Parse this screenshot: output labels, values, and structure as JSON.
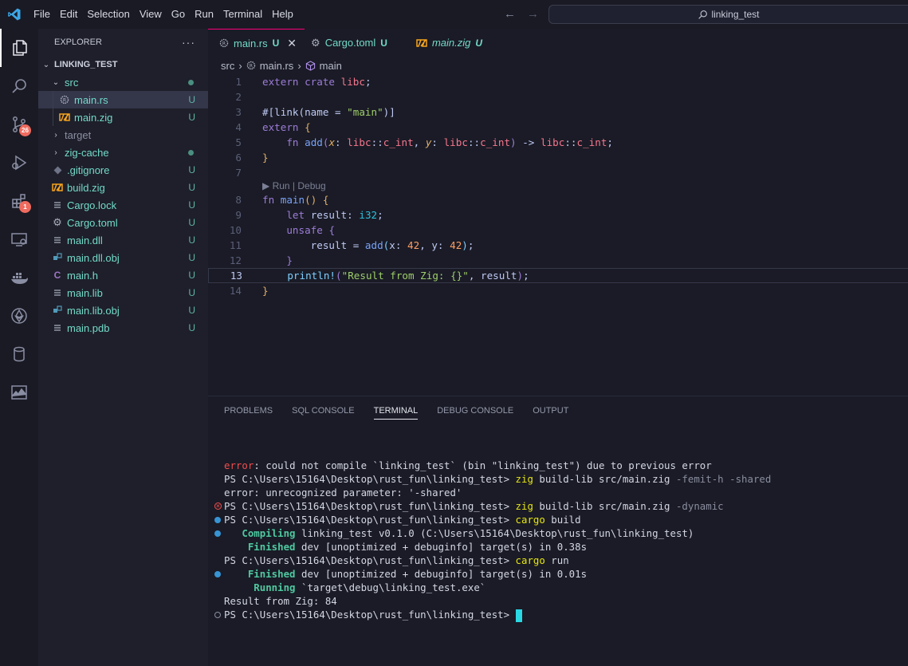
{
  "menu": [
    "File",
    "Edit",
    "Selection",
    "View",
    "Go",
    "Run",
    "Terminal",
    "Help"
  ],
  "search": {
    "text": "linking_test"
  },
  "activity": {
    "scm_badge": "26",
    "extensions_badge": "1"
  },
  "explorer": {
    "title": "EXPLORER",
    "more": "···",
    "root": "LINKING_TEST",
    "items": [
      {
        "label": "src",
        "status": ""
      },
      {
        "label": "main.rs",
        "status": "U"
      },
      {
        "label": "main.zig",
        "status": "U"
      },
      {
        "label": "target",
        "status": ""
      },
      {
        "label": "zig-cache",
        "status": ""
      },
      {
        "label": ".gitignore",
        "status": "U"
      },
      {
        "label": "build.zig",
        "status": "U"
      },
      {
        "label": "Cargo.lock",
        "status": "U"
      },
      {
        "label": "Cargo.toml",
        "status": "U"
      },
      {
        "label": "main.dll",
        "status": "U"
      },
      {
        "label": "main.dll.obj",
        "status": "U"
      },
      {
        "label": "main.h",
        "status": "U"
      },
      {
        "label": "main.lib",
        "status": "U"
      },
      {
        "label": "main.lib.obj",
        "status": "U"
      },
      {
        "label": "main.pdb",
        "status": "U"
      }
    ]
  },
  "tabs": [
    {
      "label": "main.rs",
      "status": "U"
    },
    {
      "label": "Cargo.toml",
      "status": "U"
    },
    {
      "label": "main.zig",
      "status": "U"
    }
  ],
  "breadcrumb": {
    "folder": "src",
    "file": "main.rs",
    "symbol": "main"
  },
  "editor": {
    "line_numbers": [
      "1",
      "2",
      "3",
      "4",
      "5",
      "6",
      "7",
      "8",
      "9",
      "10",
      "11",
      "12",
      "13",
      "14"
    ],
    "codelens": "▶ Run | Debug"
  },
  "panel": {
    "tabs": [
      "PROBLEMS",
      "SQL CONSOLE",
      "TERMINAL",
      "DEBUG CONSOLE",
      "OUTPUT"
    ],
    "terminal": {
      "l1_err": "error",
      "l1_rest": ": could not compile `linking_test` (bin \"linking_test\") due to previous error",
      "prompt": "PS C:\\Users\\15164\\Desktop\\rust_fun\\linking_test> ",
      "l2_cmd": "zig",
      "l2_args": " build-lib src/main.zig ",
      "l2_flags": "-femit-h -shared",
      "l3": "error: unrecognized parameter: '-shared'",
      "l4_flags": "-dynamic",
      "l5_cmd": "cargo",
      "l5_args": " build",
      "l6_kw": "   Compiling",
      "l6_rest": " linking_test v0.1.0 (C:\\Users\\15164\\Desktop\\rust_fun\\linking_test)",
      "l7_kw": "    Finished",
      "l7_rest": " dev [unoptimized + debuginfo] target(s) in 0.38s",
      "l8_args": " run",
      "l9_rest": " dev [unoptimized + debuginfo] target(s) in 0.01s",
      "l10_kw": "     Running",
      "l10_rest": " `target\\debug\\linking_test.exe`",
      "l11": "Result from Zig: 84"
    }
  }
}
